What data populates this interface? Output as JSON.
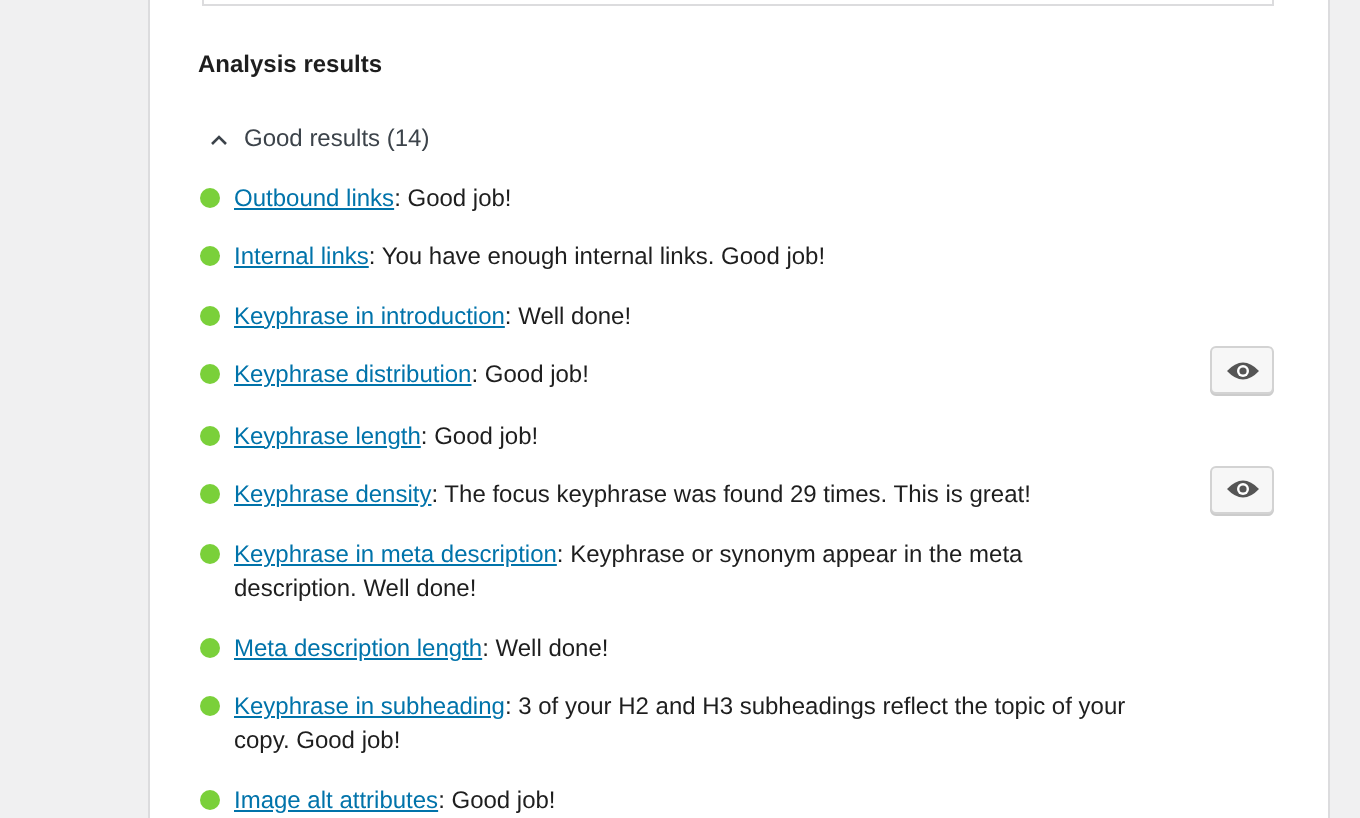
{
  "heading": "Analysis results",
  "section": {
    "label": "Good results (14)",
    "expanded": true,
    "items": [
      {
        "link": "Outbound links",
        "text": ": Good job!",
        "highlight_button": false
      },
      {
        "link": "Internal links",
        "text": ": You have enough internal links. Good job!",
        "highlight_button": false
      },
      {
        "link": "Keyphrase in introduction",
        "text": ": Well done!",
        "highlight_button": false
      },
      {
        "link": "Keyphrase distribution",
        "text": ": Good job!",
        "highlight_button": true
      },
      {
        "link": "Keyphrase length",
        "text": ": Good job!",
        "highlight_button": false
      },
      {
        "link": "Keyphrase density",
        "text": ": The focus keyphrase was found 29 times. This is great!",
        "highlight_button": true
      },
      {
        "link": "Keyphrase in meta description",
        "text": ": Keyphrase or synonym appear in the meta description. Well done!",
        "highlight_button": false
      },
      {
        "link": "Meta description length",
        "text": ": Well done!",
        "highlight_button": false
      },
      {
        "link": "Keyphrase in subheading",
        "text": ": 3 of your H2 and H3 subheadings reflect the topic of your copy. Good job!",
        "highlight_button": false
      },
      {
        "link": "Image alt attributes",
        "text": ": Good job!",
        "highlight_button": false
      }
    ]
  }
}
